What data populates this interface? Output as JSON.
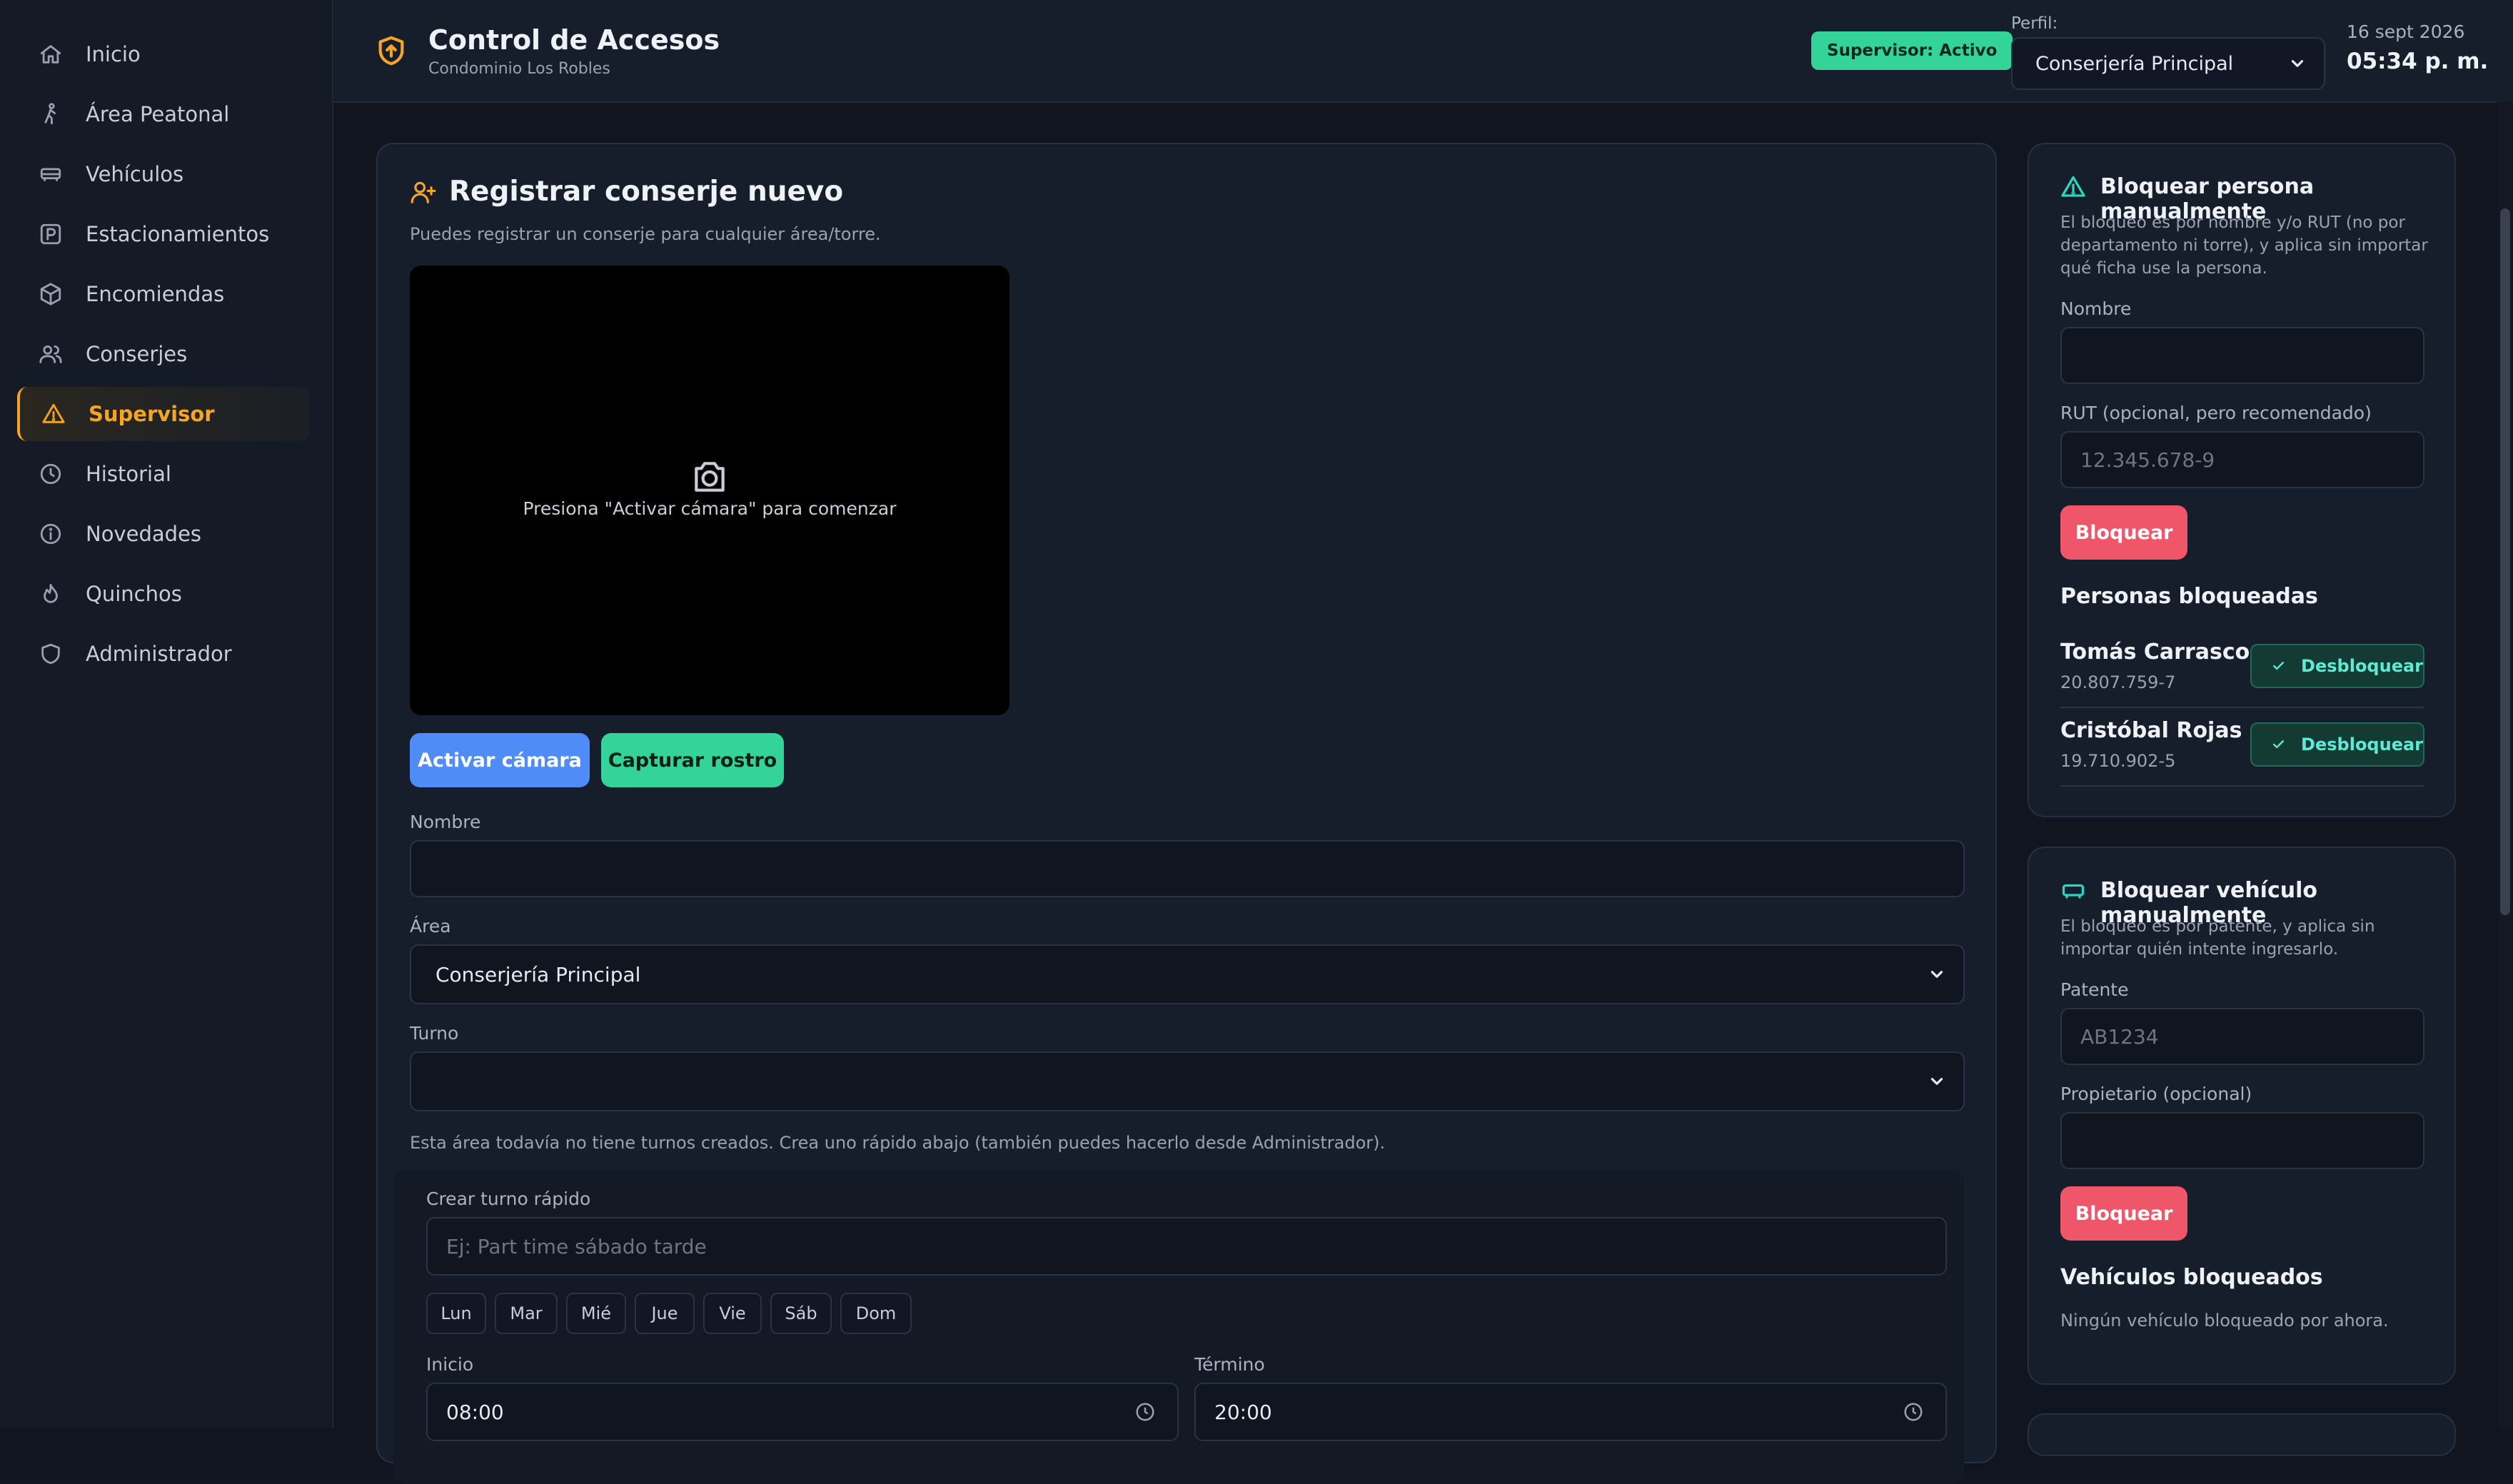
{
  "sidebar": {
    "items": [
      {
        "label": "Inicio",
        "icon": "home-icon"
      },
      {
        "label": "Área Peatonal",
        "icon": "walking-person-icon"
      },
      {
        "label": "Vehículos",
        "icon": "car-icon"
      },
      {
        "label": "Estacionamientos",
        "icon": "parking-icon"
      },
      {
        "label": "Encomiendas",
        "icon": "package-icon"
      },
      {
        "label": "Conserjes",
        "icon": "users-icon"
      },
      {
        "label": "Supervisor",
        "icon": "warning-triangle-icon",
        "active": true
      },
      {
        "label": "Historial",
        "icon": "clock-icon"
      },
      {
        "label": "Novedades",
        "icon": "info-icon"
      },
      {
        "label": "Quinchos",
        "icon": "flame-icon"
      },
      {
        "label": "Administrador",
        "icon": "shield-icon"
      }
    ]
  },
  "header": {
    "title": "Control de Accesos",
    "subtitle": "Condominio Los Robles",
    "badge": "Supervisor: Activo",
    "perfil_label": "Perfil:",
    "perfil_value": "Conserjería Principal",
    "date": "16 sept 2026",
    "time": "05:34 p. m."
  },
  "register": {
    "title": "Registrar conserje nuevo",
    "subtitle": "Puedes registrar un conserje para cualquier área/torre.",
    "camera_text": "Presiona \"Activar cámara\" para comenzar",
    "btn_activate": "Activar cámara",
    "btn_capture": "Capturar rostro",
    "nombre_label": "Nombre",
    "nombre_value": "",
    "area_label": "Área",
    "area_value": "Conserjería Principal",
    "turno_label": "Turno",
    "turno_value": "",
    "turno_hint": "Esta área todavía no tiene turnos creados. Crea uno rápido abajo (también puedes hacerlo desde Administrador).",
    "quick_label": "Crear turno rápido",
    "quick_placeholder": "Ej: Part time sábado tarde",
    "days": [
      "Lun",
      "Mar",
      "Mié",
      "Jue",
      "Vie",
      "Sáb",
      "Dom"
    ],
    "inicio_label": "Inicio",
    "inicio_value": "08:00",
    "termino_label": "Término",
    "termino_value": "20:00"
  },
  "block_person": {
    "title": "Bloquear persona manualmente",
    "desc": "El bloqueo es por nombre y/o RUT (no por departamento ni torre), y aplica sin importar qué ficha use la persona.",
    "nombre_label": "Nombre",
    "rut_label": "RUT (opcional, pero recomendado)",
    "rut_placeholder": "12.345.678-9",
    "btn": "Bloquear",
    "list_title": "Personas bloqueadas",
    "list": [
      {
        "name": "Tomás Carrasco",
        "rut": "20.807.759-7",
        "action": "Desbloquear"
      },
      {
        "name": "Cristóbal Rojas",
        "rut": "19.710.902-5",
        "action": "Desbloquear"
      }
    ]
  },
  "block_vehicle": {
    "title": "Bloquear vehículo manualmente",
    "desc": "El bloqueo es por patente, y aplica sin importar quién intente ingresarlo.",
    "patente_label": "Patente",
    "patente_placeholder": "AB1234",
    "owner_label": "Propietario (opcional)",
    "btn": "Bloquear",
    "list_title": "Vehículos bloqueados",
    "empty": "Ningún vehículo bloqueado por ahora."
  },
  "colors": {
    "accent": "#f5a524",
    "success": "#34d399",
    "primary": "#4f8cf7",
    "danger": "#f0566a"
  }
}
